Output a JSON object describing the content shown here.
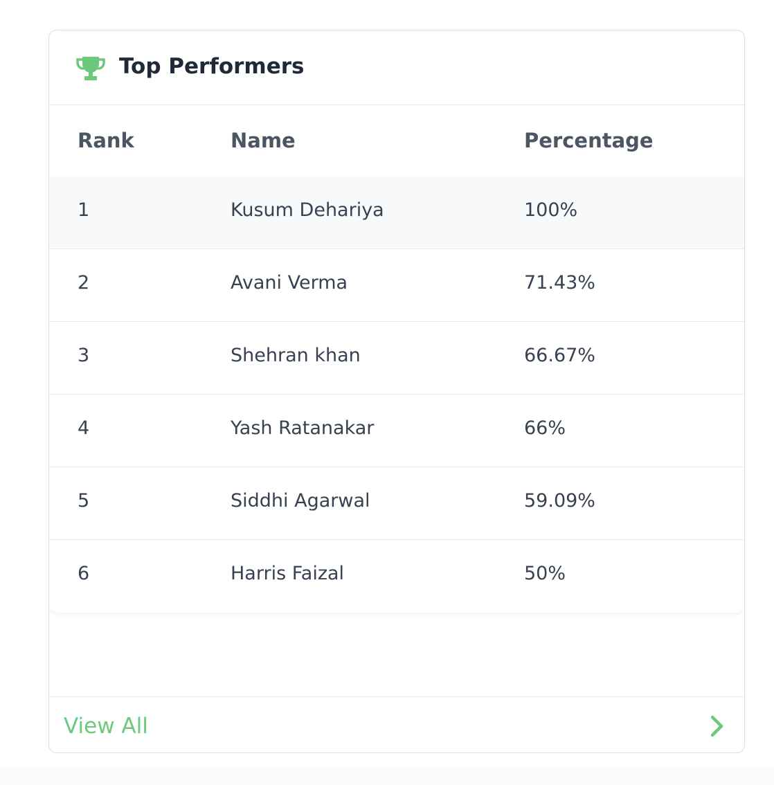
{
  "card": {
    "title": "Top Performers",
    "icon": "trophy-icon",
    "accent_color": "#6cc97c"
  },
  "table": {
    "columns": [
      "Rank",
      "Name",
      "Percentage"
    ],
    "rows": [
      {
        "rank": "1",
        "name": "Kusum Dehariya",
        "percentage": "100%"
      },
      {
        "rank": "2",
        "name": "Avani Verma",
        "percentage": "71.43%"
      },
      {
        "rank": "3",
        "name": "Shehran khan",
        "percentage": "66.67%"
      },
      {
        "rank": "4",
        "name": "Yash Ratanakar",
        "percentage": "66%"
      },
      {
        "rank": "5",
        "name": "Siddhi Agarwal",
        "percentage": "59.09%"
      },
      {
        "rank": "6",
        "name": "Harris Faizal",
        "percentage": "50%"
      }
    ]
  },
  "footer": {
    "view_all_label": "View All",
    "icon": "chevron-right-icon"
  }
}
